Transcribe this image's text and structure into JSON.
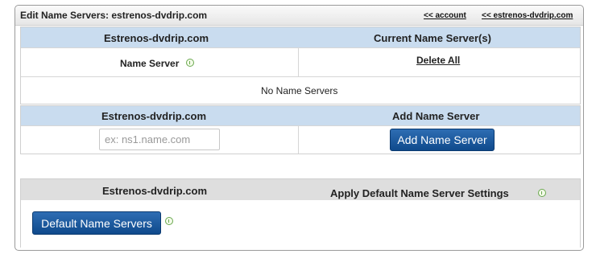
{
  "header": {
    "title": "Edit Name Servers: estrenos-dvdrip.com",
    "link_account": "<< account",
    "link_domain": "<< estrenos-dvdrip.com"
  },
  "current_section": {
    "domain_heading": "Estrenos-dvdrip.com",
    "servers_heading": "Current Name Server(s)",
    "name_server_label": "Name Server",
    "delete_all": "Delete All",
    "empty_message": "No Name Servers"
  },
  "add_section": {
    "domain_heading": "Estrenos-dvdrip.com",
    "add_heading": "Add Name Server",
    "input_placeholder": "ex: ns1.name.com",
    "input_value": "",
    "add_button": "Add Name Server"
  },
  "default_section": {
    "domain_heading": "Estrenos-dvdrip.com",
    "apply_heading": "Apply Default Name Server Settings",
    "default_button": "Default Name Servers"
  },
  "colors": {
    "blue_header": "#c9dcef",
    "gray_header": "#dedede",
    "button": "#1a579c",
    "info_icon": "#6aa84f"
  },
  "icons": [
    "info-icon"
  ]
}
